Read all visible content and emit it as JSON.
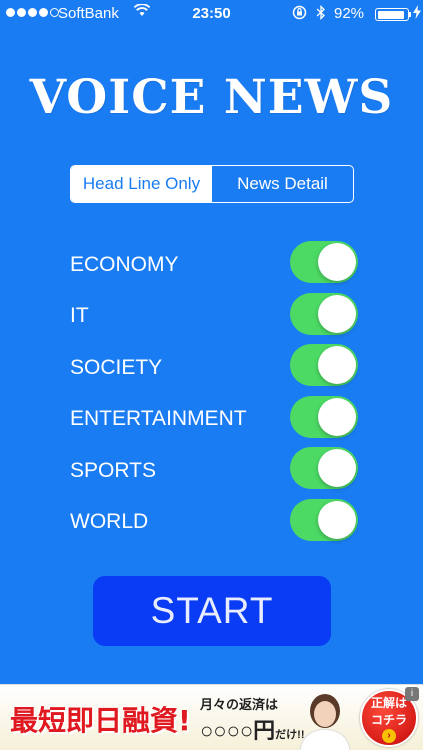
{
  "status_bar": {
    "signal_filled": 4,
    "signal_total": 5,
    "carrier": "SoftBank",
    "time": "23:50",
    "battery_percent_text": "92%",
    "battery_level": 0.92
  },
  "app_title": "VOICE NEWS",
  "mode_selector": {
    "options": [
      "Head Line Only",
      "News Detail"
    ],
    "selected": "Head Line Only"
  },
  "categories": [
    {
      "label": "ECONOMY",
      "enabled": true
    },
    {
      "label": "IT",
      "enabled": true
    },
    {
      "label": "SOCIETY",
      "enabled": true
    },
    {
      "label": "ENTERTAINMENT",
      "enabled": true
    },
    {
      "label": "SPORTS",
      "enabled": true
    },
    {
      "label": "WORLD",
      "enabled": true
    }
  ],
  "start_label": "START",
  "ad": {
    "headline": "最短即日融資!",
    "line1": "月々の返済は",
    "line2": "○○○○円",
    "line2_suffix": "だけ!!",
    "cta_line1": "正解は",
    "cta_line2": "コチラ",
    "cta_arrow": "›",
    "info": "i"
  },
  "colors": {
    "background": "#1a7cf2",
    "toggle_on": "#4cd964",
    "start_button": "#0a3cf5",
    "ad_headline": "#e0181f"
  }
}
